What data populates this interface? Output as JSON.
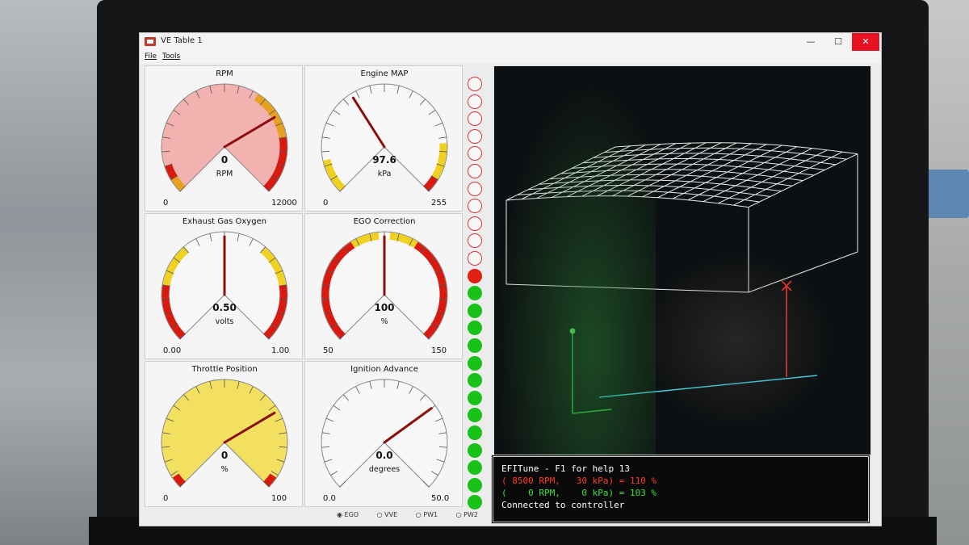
{
  "window": {
    "title": "VE Table 1",
    "minimize": "—",
    "maximize": "☐",
    "close": "✕"
  },
  "menu": [
    {
      "label": "File"
    },
    {
      "label": "Tools"
    }
  ],
  "gauges": [
    {
      "title": "RPM",
      "value": "0",
      "unit": "RPM",
      "min": "0",
      "max": "12000",
      "fill": "#f2b3b0",
      "needle_fraction": 0.72
    },
    {
      "title": "Engine MAP",
      "value": "97.6",
      "unit": "kPa",
      "min": "0",
      "max": "255",
      "fill": "#f7f7f7",
      "needle_fraction": 0.38
    },
    {
      "title": "Exhaust Gas Oxygen",
      "value": "0.50",
      "unit": "volts",
      "min": "0.00",
      "max": "1.00",
      "fill": "#f7f7f7",
      "needle_fraction": 0.5
    },
    {
      "title": "EGO Correction",
      "value": "100",
      "unit": "%",
      "min": "50",
      "max": "150",
      "fill": "#f7f7f7",
      "needle_fraction": 0.5
    },
    {
      "title": "Throttle Position",
      "value": "0",
      "unit": "%",
      "min": "0",
      "max": "100",
      "fill": "#f3e060",
      "needle_fraction": 0.72
    },
    {
      "title": "Ignition Advance",
      "value": "0.0",
      "unit": "degrees",
      "min": "0.0",
      "max": "50.0",
      "fill": "#f7f7f7",
      "needle_fraction": 0.7
    }
  ],
  "lamps": {
    "states": [
      "off",
      "off",
      "off",
      "off",
      "off",
      "off",
      "off",
      "off",
      "off",
      "off",
      "off",
      "red",
      "green",
      "green",
      "green",
      "green",
      "green",
      "green",
      "green",
      "green",
      "green",
      "green",
      "green",
      "green",
      "green"
    ],
    "colors": {
      "off": "#f7f7f7",
      "red": "#e02010",
      "green": "#19c219"
    }
  },
  "radio": [
    {
      "label": "EGO",
      "selected": true
    },
    {
      "label": "VVE",
      "selected": false
    },
    {
      "label": "PW1",
      "selected": false
    },
    {
      "label": "PW2",
      "selected": false
    }
  ],
  "console": {
    "header": "EFITune - F1 for help 13",
    "line1": "( 8500 RPM,   30 kPa) = 110 %",
    "line2": "(    0 RPM,    0 kPa) = 103 %",
    "line3": "Connected to controller",
    "colors": {
      "header": "#ffffff",
      "line1": "#ff3a2a",
      "line2": "#3ee23e",
      "line3": "#ffffff"
    }
  }
}
